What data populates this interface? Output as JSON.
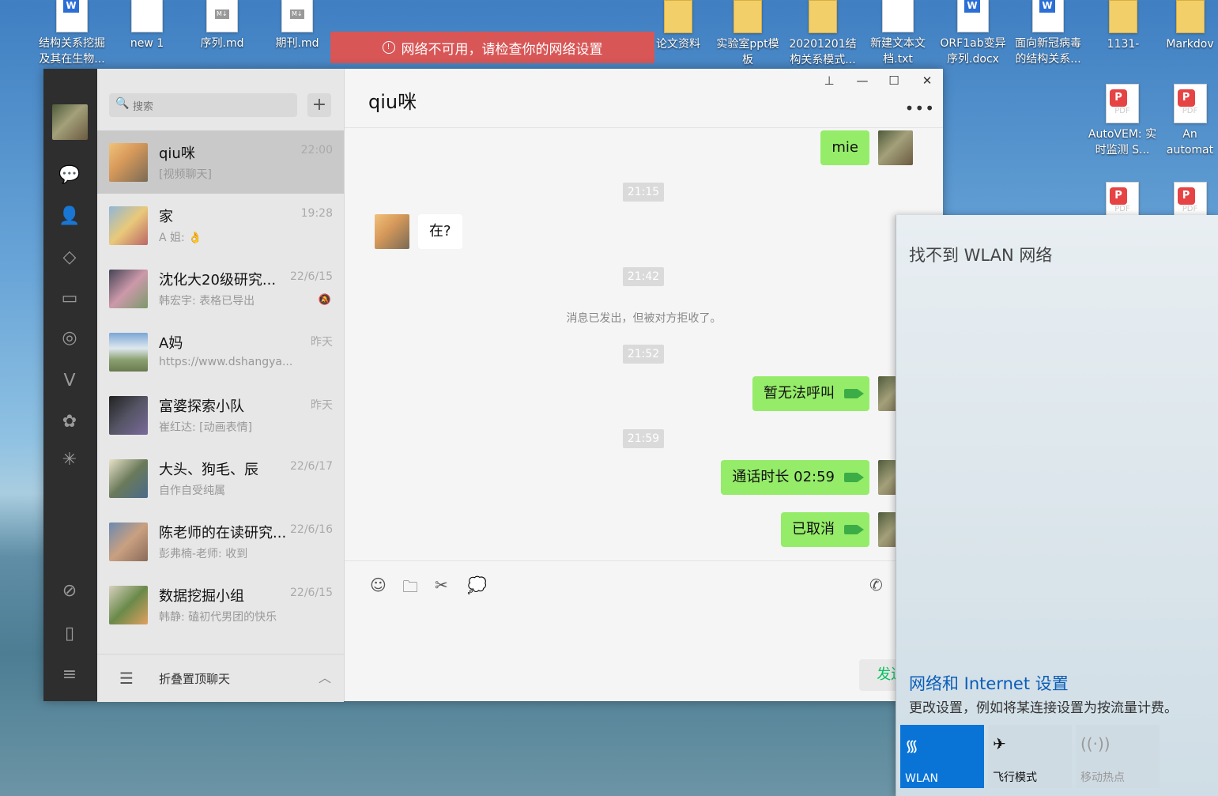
{
  "desktop": {
    "icons": [
      {
        "label": "结构关系挖掘及其在生物...",
        "kind": "word"
      },
      {
        "label": "new 1",
        "kind": "doc"
      },
      {
        "label": "序列.md",
        "kind": "md"
      },
      {
        "label": "期刊.md",
        "kind": "md"
      },
      {
        "label": "论文资料",
        "kind": "folder"
      },
      {
        "label": "实验室ppt模板",
        "kind": "folder"
      },
      {
        "label": "20201201结构关系模式...",
        "kind": "folder"
      },
      {
        "label": "新建文本文档.txt",
        "kind": "doc"
      },
      {
        "label": "ORF1ab变异序列.docx",
        "kind": "word"
      },
      {
        "label": "面向新冠病毒的结构关系...",
        "kind": "word"
      },
      {
        "label": "1131-",
        "kind": "folder"
      },
      {
        "label": "Markdov",
        "kind": "folder"
      },
      {
        "label": "AutoVEM: 实时监测 S...",
        "kind": "pdf"
      },
      {
        "label": "An automat",
        "kind": "pdf"
      }
    ],
    "toast": "网络不可用，请检查你的网络设置"
  },
  "wechat": {
    "search_placeholder": "搜索",
    "add_label": "+",
    "chats": [
      {
        "name": "qiu咪",
        "time": "22:00",
        "msg": "[视频聊天]",
        "selected": true
      },
      {
        "name": "家",
        "time": "19:28",
        "msg": "A 姐: 👌"
      },
      {
        "name": "沈化大20级研究...",
        "time": "22/6/15",
        "msg": "韩宏宇: 表格已导出",
        "muted": true
      },
      {
        "name": "A妈",
        "time": "昨天",
        "msg": "https://www.dshangya..."
      },
      {
        "name": "富婆探索小队",
        "time": "昨天",
        "msg": "崔红达: [动画表情]"
      },
      {
        "name": "大头、狗毛、辰",
        "time": "22/6/17",
        "msg": "自作自受纯属"
      },
      {
        "name": "陈老师的在读研究...",
        "time": "22/6/16",
        "msg": "彭弗楠-老师: 收到"
      },
      {
        "name": "数据挖掘小组",
        "time": "22/6/15",
        "msg": "韩静: 磕初代男团的快乐"
      }
    ],
    "fold_label": "折叠置顶聊天",
    "conversation": {
      "title": "qiu咪",
      "messages": {
        "m1": "mie",
        "t1": "21:15",
        "m2": "在?",
        "t2": "21:42",
        "sys": "消息已发出，但被对方拒收了。",
        "t3": "21:52",
        "m3": "暂无法呼叫",
        "t4": "21:59",
        "m4": "通话时长 02:59",
        "m5": "已取消"
      },
      "send_label": "发送(S)"
    }
  },
  "network_flyout": {
    "header": "找不到 WLAN 网络",
    "settings_link": "网络和 Internet 设置",
    "settings_desc": "更改设置，例如将某连接设置为按流量计费。",
    "tiles": [
      {
        "label": "WLAN",
        "state": "on"
      },
      {
        "label": "飞行模式",
        "state": "off"
      },
      {
        "label": "移动热点",
        "state": "disabled"
      }
    ]
  },
  "colors": {
    "wechat_green": "#07c160",
    "bubble_green": "#95ec69",
    "toast_red": "#d85656",
    "windows_accent": "#0a74d6"
  }
}
